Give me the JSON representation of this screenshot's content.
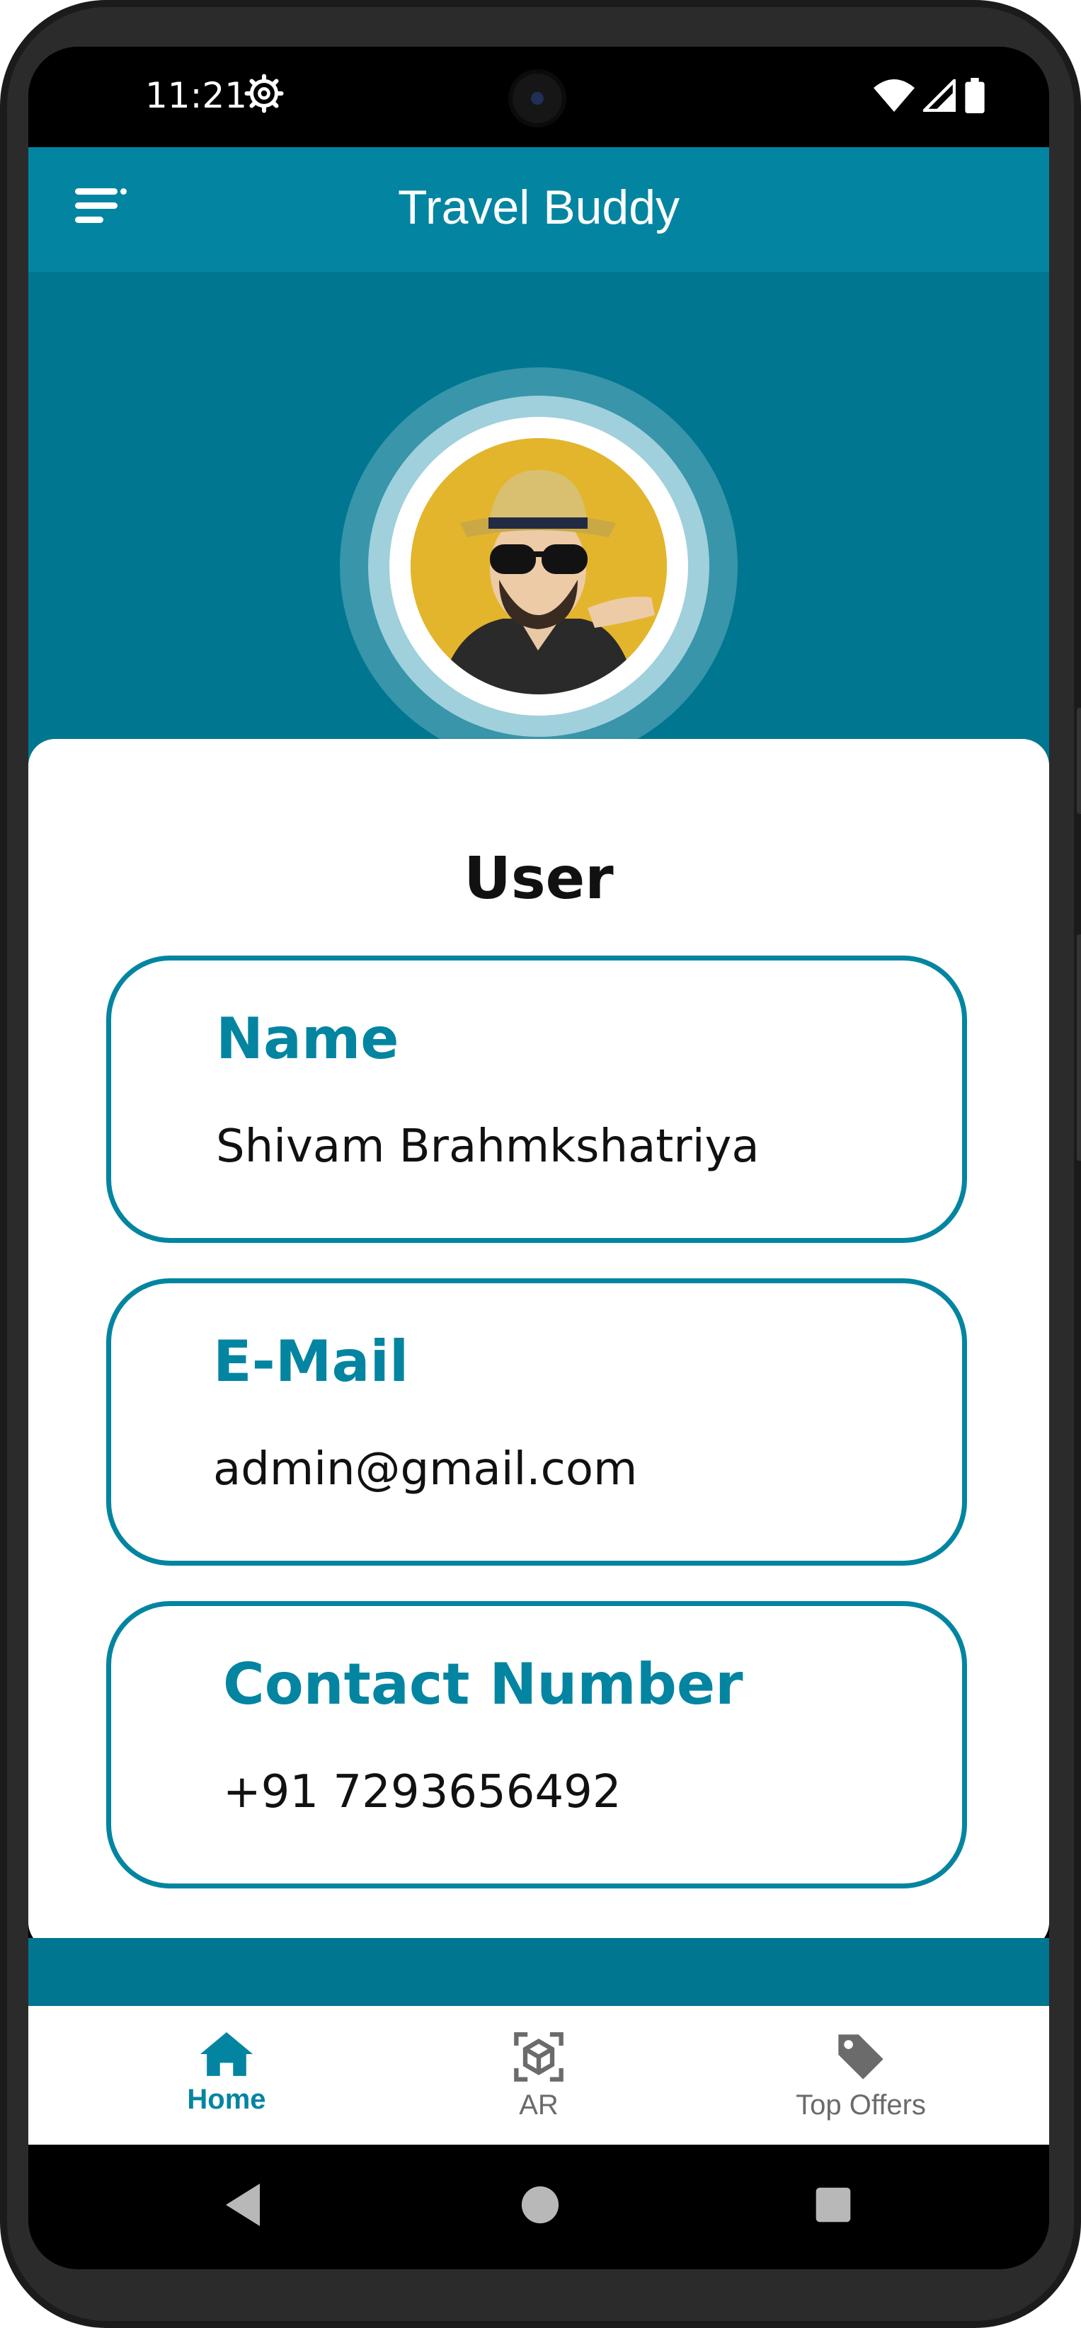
{
  "status_bar": {
    "time": "11:21"
  },
  "app_bar": {
    "title": "Travel Buddy"
  },
  "profile": {
    "role": "User",
    "fields": [
      {
        "label": "Name",
        "value": "Shivam Brahmkshatriya"
      },
      {
        "label": "E-Mail",
        "value": "admin@gmail.com"
      },
      {
        "label": "Contact Number",
        "value": "+91 7293656492"
      }
    ]
  },
  "bottom_nav": {
    "items": [
      {
        "label": "Home",
        "icon": "home-icon",
        "active": true
      },
      {
        "label": "AR",
        "icon": "ar-cube-icon",
        "active": false
      },
      {
        "label": "Top Offers",
        "icon": "tag-icon",
        "active": false
      }
    ]
  },
  "colors": {
    "primary": "#0385a1",
    "header": "#007690",
    "inactive": "#6b6b6b",
    "text": "#111111"
  }
}
